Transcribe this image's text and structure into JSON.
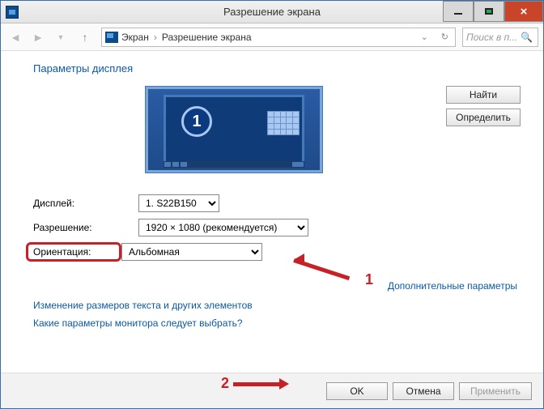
{
  "window": {
    "title": "Разрешение экрана"
  },
  "nav": {
    "crumb1": "Экран",
    "crumb2": "Разрешение экрана",
    "search_placeholder": "Поиск в п..."
  },
  "content": {
    "heading": "Параметры дисплея",
    "monitor_number": "1",
    "buttons": {
      "find": "Найти",
      "identify": "Определить"
    },
    "labels": {
      "display": "Дисплей:",
      "resolution": "Разрешение:",
      "orientation": "Ориентация:"
    },
    "values": {
      "display": "1. S22B150",
      "resolution": "1920 × 1080 (рекомендуется)",
      "orientation": "Альбомная"
    },
    "links": {
      "advanced": "Дополнительные параметры",
      "text_size": "Изменение размеров текста и других элементов",
      "which_monitor": "Какие параметры монитора следует выбрать?"
    }
  },
  "footer": {
    "ok": "OK",
    "cancel": "Отмена",
    "apply": "Применить"
  },
  "annotations": {
    "n1": "1",
    "n2": "2"
  }
}
